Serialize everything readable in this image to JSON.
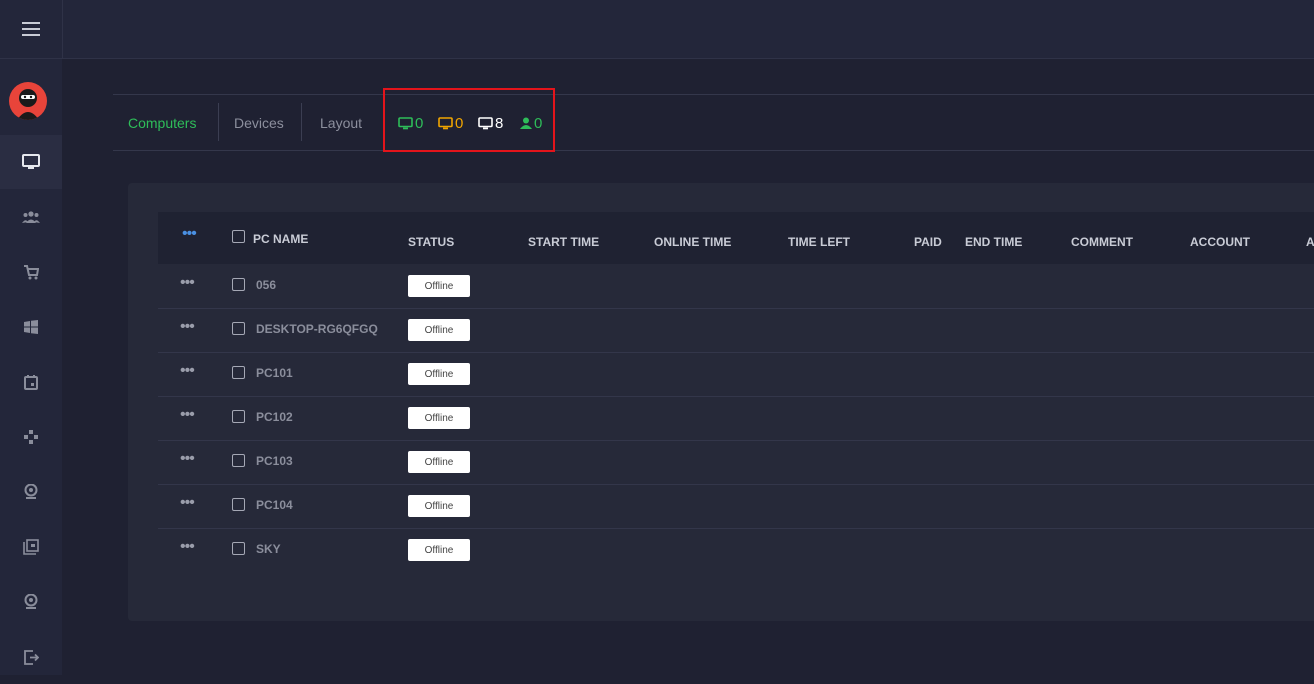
{
  "tabs": [
    "Computers",
    "Devices",
    "Layout"
  ],
  "counters": [
    {
      "icon": "monitor-icon",
      "value": "0",
      "color": "#2ebd59"
    },
    {
      "icon": "monitor-icon",
      "value": "0",
      "color": "#f0a500"
    },
    {
      "icon": "monitor-icon",
      "value": "8",
      "color": "#ffffff"
    },
    {
      "icon": "user-icon",
      "value": "0",
      "color": "#2ebd59"
    }
  ],
  "table": {
    "headers": {
      "pc_name": "PC NAME",
      "status": "STATUS",
      "start_time": "START TIME",
      "online_time": "ONLINE TIME",
      "time_left": "TIME LEFT",
      "paid": "PAID",
      "end_time": "END TIME",
      "comment": "COMMENT",
      "account": "ACCOUNT",
      "extra": "A"
    },
    "rows": [
      {
        "name": "056",
        "status": "Offline"
      },
      {
        "name": "DESKTOP-RG6QFGQ",
        "status": "Offline"
      },
      {
        "name": "PC101",
        "status": "Offline"
      },
      {
        "name": "PC102",
        "status": "Offline"
      },
      {
        "name": "PC103",
        "status": "Offline"
      },
      {
        "name": "PC104",
        "status": "Offline"
      },
      {
        "name": "SKY",
        "status": "Offline"
      }
    ]
  },
  "sidebar_icons": [
    "monitor-icon",
    "users-icon",
    "cart-icon",
    "windows-icon",
    "calendar-icon",
    "gamepad-icon",
    "webcam-icon",
    "copy-icon",
    "webcam-icon",
    "logout-icon"
  ],
  "colors": {
    "accent": "#2ebd59",
    "warning": "#f0a500",
    "highlight": "#e3141b",
    "dots_active": "#4a90e2"
  }
}
